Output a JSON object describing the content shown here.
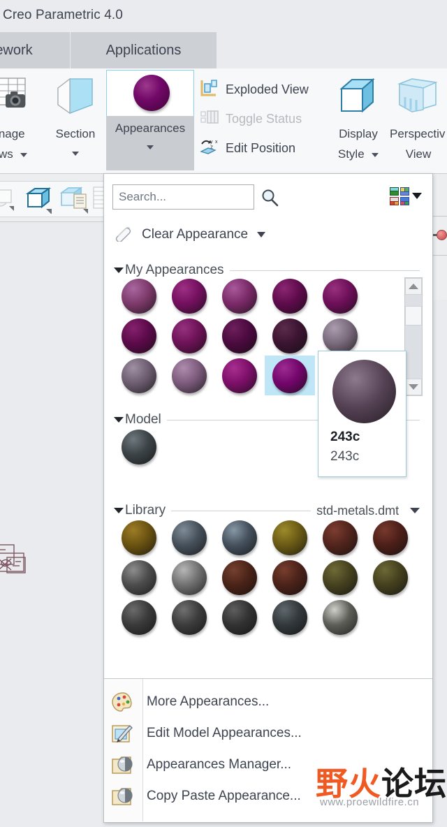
{
  "window": {
    "title": "Creo Parametric 4.0"
  },
  "ribbon": {
    "tabs": [
      {
        "label": "ework"
      },
      {
        "label": "Applications"
      }
    ],
    "groups": {
      "manage_views": {
        "label_line1": "anage",
        "label_line2": "iews",
        "icon": "manage-views-icon"
      },
      "section": {
        "label": "Section",
        "icon": "section-icon"
      },
      "appearances": {
        "label": "Appearances",
        "icon": "appearance-sphere-icon"
      },
      "display_style": {
        "label_line1": "Display",
        "label_line2": "Style",
        "icon": "display-style-cube-icon"
      },
      "perspective_view": {
        "label_line1": "Perspectiv",
        "label_line2": "View",
        "icon": "perspective-cube-icon"
      }
    },
    "commands": [
      {
        "label": "Exploded View",
        "icon": "exploded-view-icon",
        "disabled": false
      },
      {
        "label": "Toggle Status",
        "icon": "toggle-status-icon",
        "disabled": true
      },
      {
        "label": "Edit Position",
        "icon": "edit-position-icon",
        "disabled": false
      }
    ]
  },
  "panel": {
    "search": {
      "value": "",
      "placeholder": "Search...",
      "icon": "search-magnifier-icon"
    },
    "palette_button": {
      "icon": "color-palette-grid-icon",
      "caret": "chevron-down-icon"
    },
    "clear_appearance": {
      "label": "Clear Appearance",
      "icon": "eraser-icon",
      "caret": "chevron-down-icon"
    },
    "sections": {
      "my_appearances": {
        "title": "My Appearances",
        "swatches": [
          {
            "name": "ref-purple-1",
            "base": "#7e3a6b",
            "hi": "#a767a0"
          },
          {
            "name": "ref-purple-2",
            "base": "#74105f",
            "hi": "#9e2f84"
          },
          {
            "name": "ref-purple-3",
            "base": "#7b2a68",
            "hi": "#a8599a"
          },
          {
            "name": "ref-purple-4",
            "base": "#5f0b4c",
            "hi": "#8a2672"
          },
          {
            "name": "ref-purple-5",
            "base": "#6e0f59",
            "hi": "#97307e"
          },
          {
            "name": "ref-purple-6",
            "base": "#5c0a4a",
            "hi": "#85216d"
          },
          {
            "name": "ref-purple-7",
            "base": "#6d1257",
            "hi": "#963180"
          },
          {
            "name": "ref-purple-8",
            "base": "#4b0a3f",
            "hi": "#6e1f5c"
          },
          {
            "name": "ref-purple-9",
            "base": "#3b1431",
            "hi": "#5b2b4c"
          },
          {
            "name": "ref-purple-10",
            "base": "#7a6a7d",
            "hi": "#ab9cae"
          },
          {
            "name": "ref-purple-11",
            "base": "#6e5d71",
            "hi": "#9f90a3"
          },
          {
            "name": "ref-purple-12",
            "base": "#7c5b7c",
            "hi": "#ad8cae"
          },
          {
            "name": "ref-purple-13",
            "base": "#7d0f69",
            "hi": "#a82e8f"
          },
          {
            "name": "ref-purple-14",
            "base": "#73066b",
            "hi": "#9c2b92",
            "selected": true
          }
        ],
        "selected_index": 13,
        "scrollbar": {
          "up": "scroll-up-arrow",
          "down": "scroll-down-arrow"
        }
      },
      "model": {
        "title": "Model",
        "swatches": [
          {
            "name": "model-dark-gray",
            "base": "#3c4347",
            "hi": "#6e787e"
          }
        ]
      },
      "library": {
        "title": "Library",
        "source": "std-metals.dmt",
        "caret": "chevron-down-icon",
        "swatches": [
          {
            "name": "lib-brass",
            "base": "#6a5211",
            "hi": "#9c7c26"
          },
          {
            "name": "lib-steel-blue",
            "base": "#46505a",
            "hi": "#7f8c98"
          },
          {
            "name": "lib-steel-blue-2",
            "base": "#44505c",
            "hi": "#8797a4"
          },
          {
            "name": "lib-olive-gold",
            "base": "#6a5a15",
            "hi": "#9d8a2b"
          },
          {
            "name": "lib-copper-dark",
            "base": "#51241c",
            "hi": "#7c3d31"
          },
          {
            "name": "lib-copper-red",
            "base": "#4c1f18",
            "hi": "#77392d"
          },
          {
            "name": "lib-gray-medium",
            "base": "#4c4c4c",
            "hi": "#8d8d8d"
          },
          {
            "name": "lib-gray-light",
            "base": "#707070",
            "hi": "#b6b6b6"
          },
          {
            "name": "lib-rust",
            "base": "#4a2318",
            "hi": "#75402f"
          },
          {
            "name": "lib-rust-2",
            "base": "#4b2219",
            "hi": "#773e2e"
          },
          {
            "name": "lib-olive-dark",
            "base": "#45411f",
            "hi": "#6f6a37"
          },
          {
            "name": "lib-olive-dark-2",
            "base": "#44401e",
            "hi": "#6d6836"
          },
          {
            "name": "lib-charcoal-1",
            "base": "#3a3a3a",
            "hi": "#6b6b6b"
          },
          {
            "name": "lib-charcoal-2",
            "base": "#3c3c3c",
            "hi": "#707070"
          },
          {
            "name": "lib-charcoal-3",
            "base": "#323232",
            "hi": "#5e5e5e"
          },
          {
            "name": "lib-charcoal-4",
            "base": "#32383c",
            "hi": "#60686d"
          },
          {
            "name": "lib-silver",
            "base": "#5e5e58",
            "hi": "#cfd0c9"
          }
        ]
      }
    },
    "tooltip": {
      "title": "243c",
      "subtitle": "243c",
      "swatch": {
        "name": "tooltip-sphere-243c",
        "base": "#554254",
        "hi": "#8e7a8e"
      }
    },
    "menu": [
      {
        "label": "More Appearances...",
        "icon": "palette-icon"
      },
      {
        "label": "Edit Model Appearances...",
        "icon": "edit-model-appearances-icon"
      },
      {
        "label": "Appearances Manager...",
        "icon": "appearances-manager-icon"
      },
      {
        "label": "Copy Paste Appearance...",
        "icon": "copy-paste-appearance-icon"
      }
    ]
  },
  "watermark": {
    "text_ye": "野火",
    "text_rest": "论坛",
    "url": "www.proewildfire.cn"
  },
  "colors": {
    "accent_blue": "#8ed0ef",
    "selection_blue": "#bfe6f7",
    "chrome_gray": "#e9ebee",
    "tab_gray": "#cdd1d6",
    "text": "#3d4450"
  }
}
